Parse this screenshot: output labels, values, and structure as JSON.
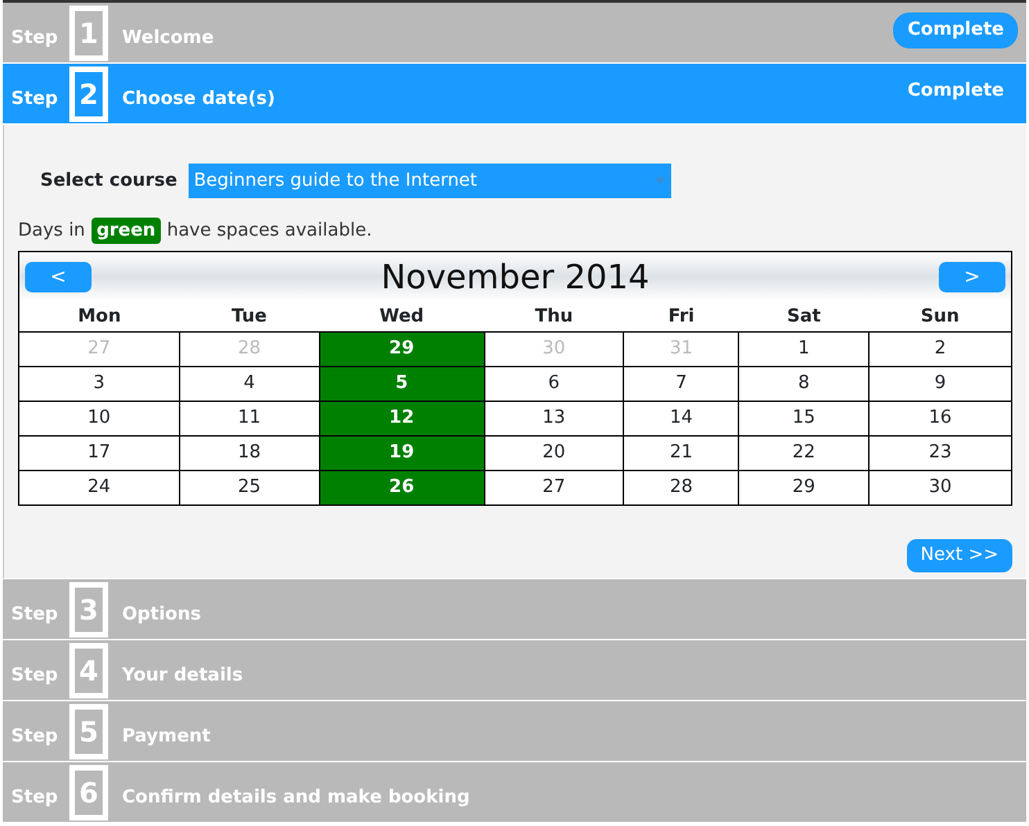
{
  "steps": [
    {
      "prefix": "Step",
      "number": "1",
      "title": "Welcome",
      "selected": false,
      "status": "Complete"
    },
    {
      "prefix": "Step",
      "number": "2",
      "title": "Choose date(s)",
      "selected": true,
      "status": "Complete"
    },
    {
      "prefix": "Step",
      "number": "3",
      "title": "Options",
      "selected": false
    },
    {
      "prefix": "Step",
      "number": "4",
      "title": "Your details",
      "selected": false
    },
    {
      "prefix": "Step",
      "number": "5",
      "title": "Payment",
      "selected": false
    },
    {
      "prefix": "Step",
      "number": "6",
      "title": "Confirm details and make booking",
      "selected": false
    }
  ],
  "course": {
    "label": "Select course",
    "value": "Beginners guide to the Internet"
  },
  "legend": {
    "before": "Days in",
    "highlight": "green",
    "after": "have spaces available."
  },
  "calendar": {
    "prev": "<",
    "month": "November 2014",
    "next": ">",
    "weekdays": [
      "Mon",
      "Tue",
      "Wed",
      "Thu",
      "Fri",
      "Sat",
      "Sun"
    ],
    "weeks": [
      [
        {
          "day": "27",
          "muted": true,
          "available": false
        },
        {
          "day": "28",
          "muted": true,
          "available": false
        },
        {
          "day": "29",
          "muted": false,
          "available": true
        },
        {
          "day": "30",
          "muted": true,
          "available": false
        },
        {
          "day": "31",
          "muted": true,
          "available": false
        },
        {
          "day": "1",
          "muted": false,
          "available": false
        },
        {
          "day": "2",
          "muted": false,
          "available": false
        }
      ],
      [
        {
          "day": "3",
          "muted": false,
          "available": false
        },
        {
          "day": "4",
          "muted": false,
          "available": false
        },
        {
          "day": "5",
          "muted": false,
          "available": true
        },
        {
          "day": "6",
          "muted": false,
          "available": false
        },
        {
          "day": "7",
          "muted": false,
          "available": false
        },
        {
          "day": "8",
          "muted": false,
          "available": false
        },
        {
          "day": "9",
          "muted": false,
          "available": false
        }
      ],
      [
        {
          "day": "10",
          "muted": false,
          "available": false
        },
        {
          "day": "11",
          "muted": false,
          "available": false
        },
        {
          "day": "12",
          "muted": false,
          "available": true
        },
        {
          "day": "13",
          "muted": false,
          "available": false
        },
        {
          "day": "14",
          "muted": false,
          "available": false
        },
        {
          "day": "15",
          "muted": false,
          "available": false
        },
        {
          "day": "16",
          "muted": false,
          "available": false
        }
      ],
      [
        {
          "day": "17",
          "muted": false,
          "available": false
        },
        {
          "day": "18",
          "muted": false,
          "available": false
        },
        {
          "day": "19",
          "muted": false,
          "available": true
        },
        {
          "day": "20",
          "muted": false,
          "available": false
        },
        {
          "day": "21",
          "muted": false,
          "available": false
        },
        {
          "day": "22",
          "muted": false,
          "available": false
        },
        {
          "day": "23",
          "muted": false,
          "available": false
        }
      ],
      [
        {
          "day": "24",
          "muted": false,
          "available": false
        },
        {
          "day": "25",
          "muted": false,
          "available": false
        },
        {
          "day": "26",
          "muted": false,
          "available": true
        },
        {
          "day": "27",
          "muted": false,
          "available": false
        },
        {
          "day": "28",
          "muted": false,
          "available": false
        },
        {
          "day": "29",
          "muted": false,
          "available": false
        },
        {
          "day": "30",
          "muted": false,
          "available": false
        }
      ]
    ]
  },
  "next_button": "Next >>"
}
